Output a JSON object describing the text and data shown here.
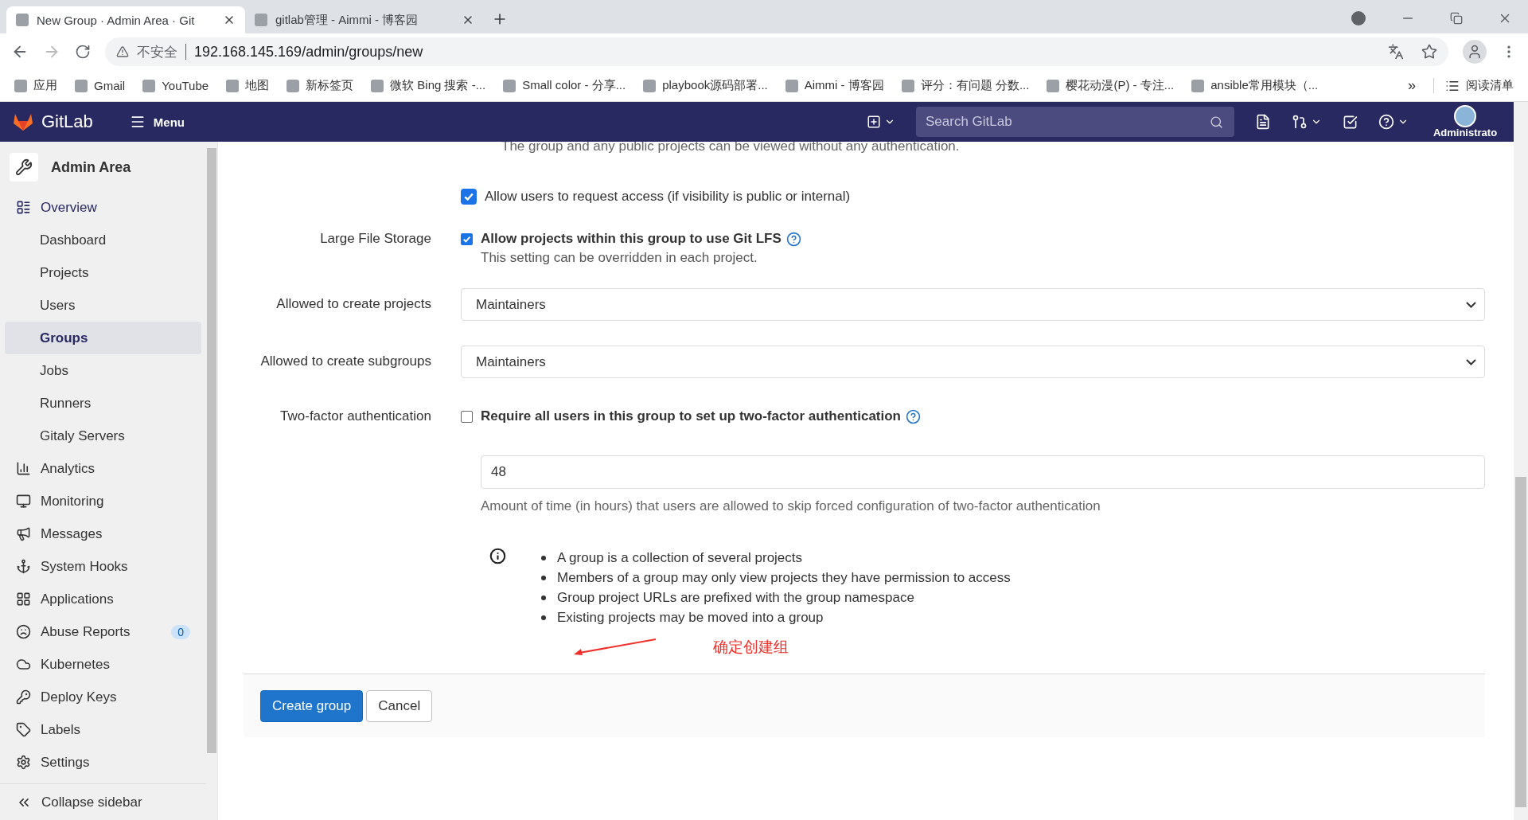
{
  "browser": {
    "tabs": [
      {
        "title": "New Group · Admin Area · Git",
        "selected": true
      },
      {
        "title": "gitlab管理 - Aimmi - 博客园",
        "selected": false
      }
    ],
    "security_label": "不安全",
    "url": "192.168.145.169/admin/groups/new",
    "bookmarks": [
      "应用",
      "Gmail",
      "YouTube",
      "地图",
      "新标签页",
      "微软 Bing 搜索 -...",
      "Small color - 分享...",
      "playbook源码部署...",
      "Aimmi - 博客园",
      "评分：有问题 分数...",
      "樱花动漫(P) - 专注...",
      "ansible常用模块（..."
    ],
    "bookmarks_more": "»",
    "reading_list": "阅读清单"
  },
  "header": {
    "brand": "GitLab",
    "menu": "Menu",
    "search": {
      "placeholder": "Search GitLab"
    },
    "user": "Administrato"
  },
  "sidebar": {
    "title": "Admin Area",
    "items": [
      {
        "label": "Overview",
        "selected": true,
        "children": [
          {
            "label": "Dashboard",
            "selected": false
          },
          {
            "label": "Projects",
            "selected": false
          },
          {
            "label": "Users",
            "selected": false
          },
          {
            "label": "Groups",
            "selected": true
          },
          {
            "label": "Jobs",
            "selected": false
          },
          {
            "label": "Runners",
            "selected": false
          },
          {
            "label": "Gitaly Servers",
            "selected": false
          }
        ]
      },
      {
        "label": "Analytics",
        "selected": false
      },
      {
        "label": "Monitoring",
        "selected": false
      },
      {
        "label": "Messages",
        "selected": false
      },
      {
        "label": "System Hooks",
        "selected": false
      },
      {
        "label": "Applications",
        "selected": false
      },
      {
        "label": "Abuse Reports",
        "selected": false,
        "badge": "0"
      },
      {
        "label": "Kubernetes",
        "selected": false
      },
      {
        "label": "Deploy Keys",
        "selected": false
      },
      {
        "label": "Labels",
        "selected": false
      },
      {
        "label": "Settings",
        "selected": false
      }
    ],
    "collapse": "Collapse sidebar"
  },
  "form": {
    "visibility_note": "The group and any public projects can be viewed without any authentication.",
    "request_access": {
      "label": "Allow users to request access (if visibility is public or internal)",
      "checked": true
    },
    "lfs": {
      "label": "Large File Storage",
      "option": "Allow projects within this group to use Git LFS",
      "checked": true,
      "help": "This setting can be overridden in each project."
    },
    "create_projects": {
      "label": "Allowed to create projects",
      "value": "Maintainers"
    },
    "create_subgroups": {
      "label": "Allowed to create subgroups",
      "value": "Maintainers"
    },
    "two_factor": {
      "label": "Two-factor authentication",
      "option": "Require all users in this group to set up two-factor authentication",
      "checked": false
    },
    "grace_period": {
      "value": "48",
      "help": "Amount of time (in hours) that users are allowed to skip forced configuration of two-factor authentication"
    },
    "info": [
      "A group is a collection of several projects",
      "Members of a group may only view projects they have permission to access",
      "Group project URLs are prefixed with the group namespace",
      "Existing projects may be moved into a group"
    ],
    "annotation": "确定创建组",
    "buttons": {
      "submit": "Create group",
      "cancel": "Cancel"
    }
  }
}
